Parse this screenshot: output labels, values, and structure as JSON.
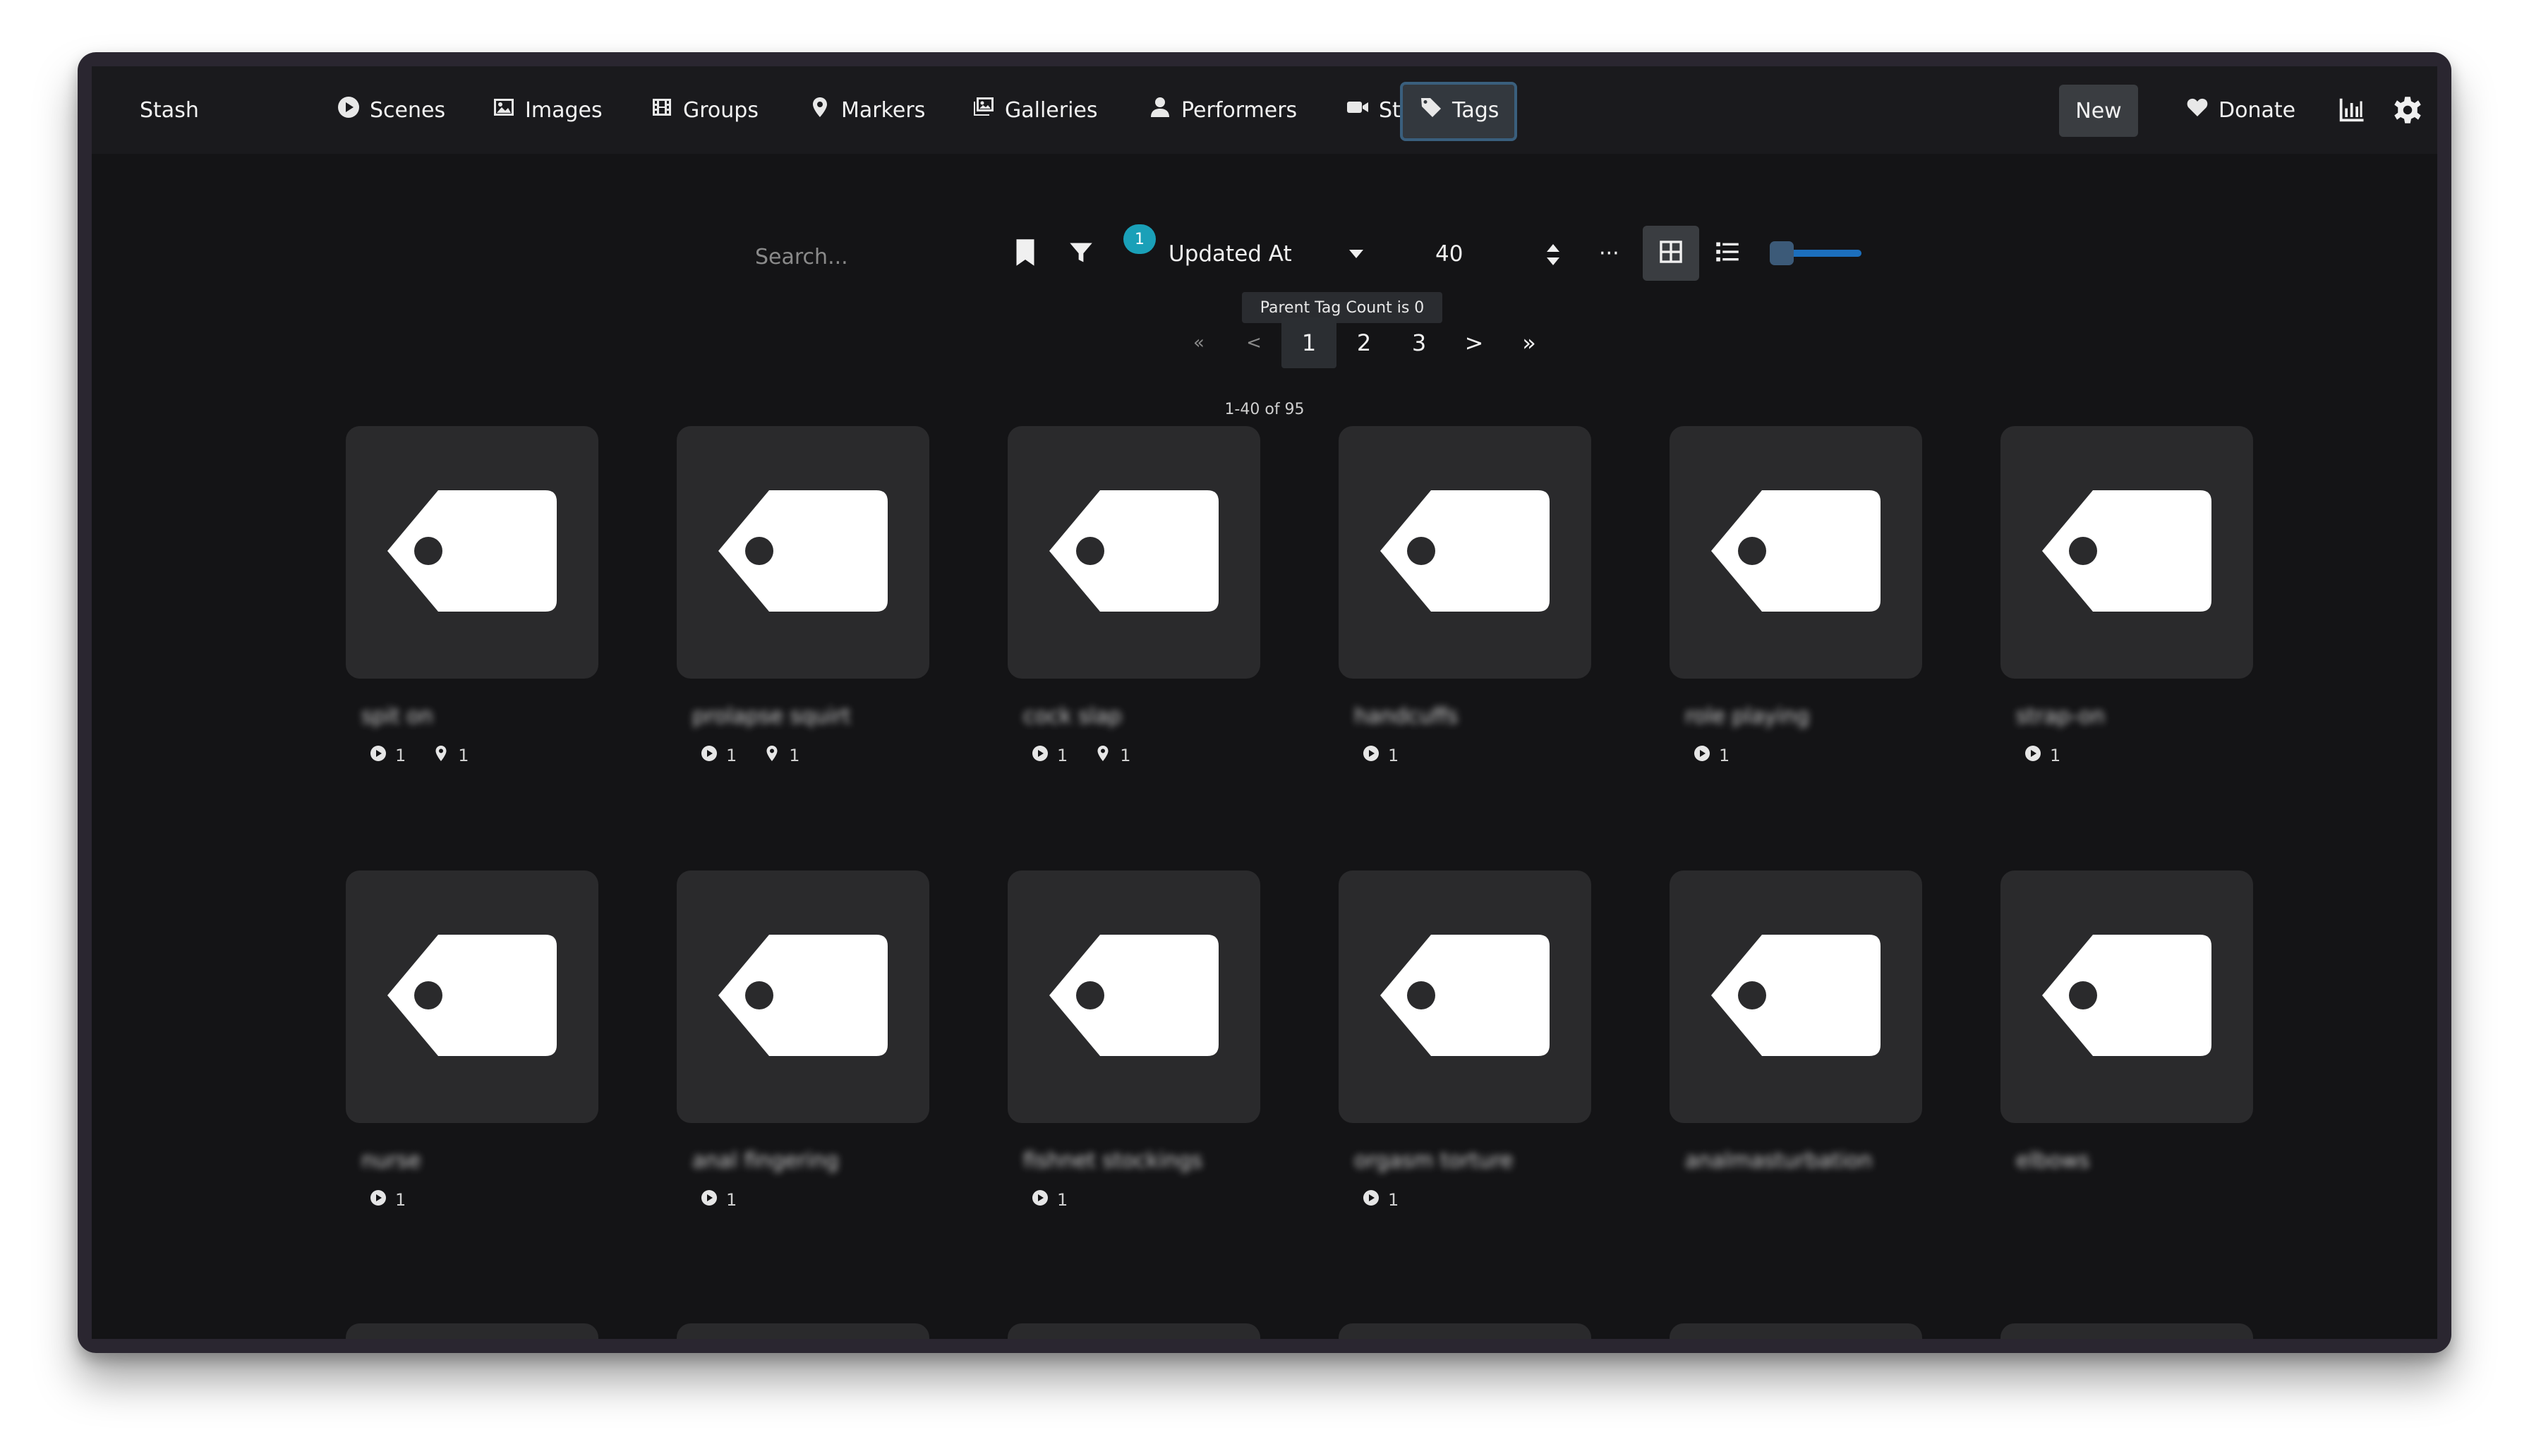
{
  "nav": {
    "brand": "Stash",
    "items": [
      {
        "label": "Scenes",
        "icon": "play-circle-icon"
      },
      {
        "label": "Images",
        "icon": "image-icon"
      },
      {
        "label": "Groups",
        "icon": "film-icon"
      },
      {
        "label": "Markers",
        "icon": "map-marker-icon"
      },
      {
        "label": "Galleries",
        "icon": "images-icon"
      },
      {
        "label": "Performers",
        "icon": "user-icon"
      },
      {
        "label": "Studios",
        "icon": "video-camera-icon"
      },
      {
        "label": "Tags",
        "icon": "tag-icon"
      }
    ],
    "active": "Tags",
    "new_label": "New",
    "donate_label": "Donate"
  },
  "toolbar": {
    "search_placeholder": "Search...",
    "filter_count": "1",
    "sort_by": "Updated At",
    "per_page": "40",
    "more": "···",
    "active_filter": "Parent Tag Count is 0"
  },
  "pagination": {
    "first": "«",
    "prev": "<",
    "pages": [
      "1",
      "2",
      "3"
    ],
    "current": "1",
    "next": ">",
    "last": "»",
    "count": "1-40 of 95"
  },
  "tags": [
    {
      "name": "spit on",
      "scenes": "1",
      "markers": "1"
    },
    {
      "name": "prolapse squirt",
      "scenes": "1",
      "markers": "1"
    },
    {
      "name": "cock slap",
      "scenes": "1",
      "markers": "1"
    },
    {
      "name": "handcuffs",
      "scenes": "1",
      "markers": null
    },
    {
      "name": "role playing",
      "scenes": "1",
      "markers": null
    },
    {
      "name": "strap-on",
      "scenes": "1",
      "markers": null
    },
    {
      "name": "nurse",
      "scenes": "1",
      "markers": null
    },
    {
      "name": "anal fingering",
      "scenes": "1",
      "markers": null
    },
    {
      "name": "fishnet stockings",
      "scenes": "1",
      "markers": null
    },
    {
      "name": "orgasm torture",
      "scenes": "1",
      "markers": null
    },
    {
      "name": "analmasturbation",
      "scenes": null,
      "markers": null
    },
    {
      "name": "elbows",
      "scenes": null,
      "markers": null
    }
  ],
  "colors": {
    "background": "#141416",
    "navbar": "#1a1a1d",
    "card": "#2a2a2c",
    "accent_badge": "#1aa0b8",
    "slider": "#1c6fbd"
  }
}
